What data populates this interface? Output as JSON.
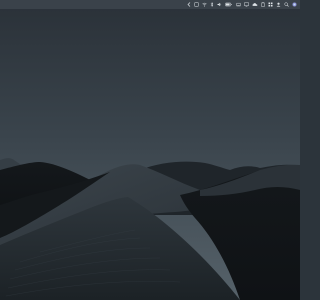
{
  "desktop": {
    "wallpaper": {
      "name": "desert-dunes-dark",
      "sky_top_color": "#2b3239",
      "sky_bottom_color": "#4d5961",
      "dune_color": "#1d2328"
    }
  },
  "menubar": {
    "background": "#3a424a",
    "status_items": [
      {
        "icon": "sidebar-toggle-icon",
        "label": ""
      },
      {
        "icon": "control-center-icon",
        "label": ""
      },
      {
        "icon": "wifi-icon",
        "label": ""
      },
      {
        "icon": "bluetooth-icon",
        "label": ""
      },
      {
        "icon": "volume-icon",
        "label": ""
      },
      {
        "icon": "battery-icon",
        "label": ""
      },
      {
        "icon": "keyboard-icon",
        "label": ""
      },
      {
        "icon": "display-icon",
        "label": ""
      },
      {
        "icon": "cloud-icon",
        "label": ""
      },
      {
        "icon": "clipboard-icon",
        "label": ""
      },
      {
        "icon": "grid-icon",
        "label": ""
      },
      {
        "icon": "user-icon",
        "label": ""
      },
      {
        "icon": "spotlight-icon",
        "label": ""
      },
      {
        "icon": "siri-icon",
        "label": ""
      },
      {
        "icon": "notification-center-icon",
        "label": ""
      }
    ]
  }
}
